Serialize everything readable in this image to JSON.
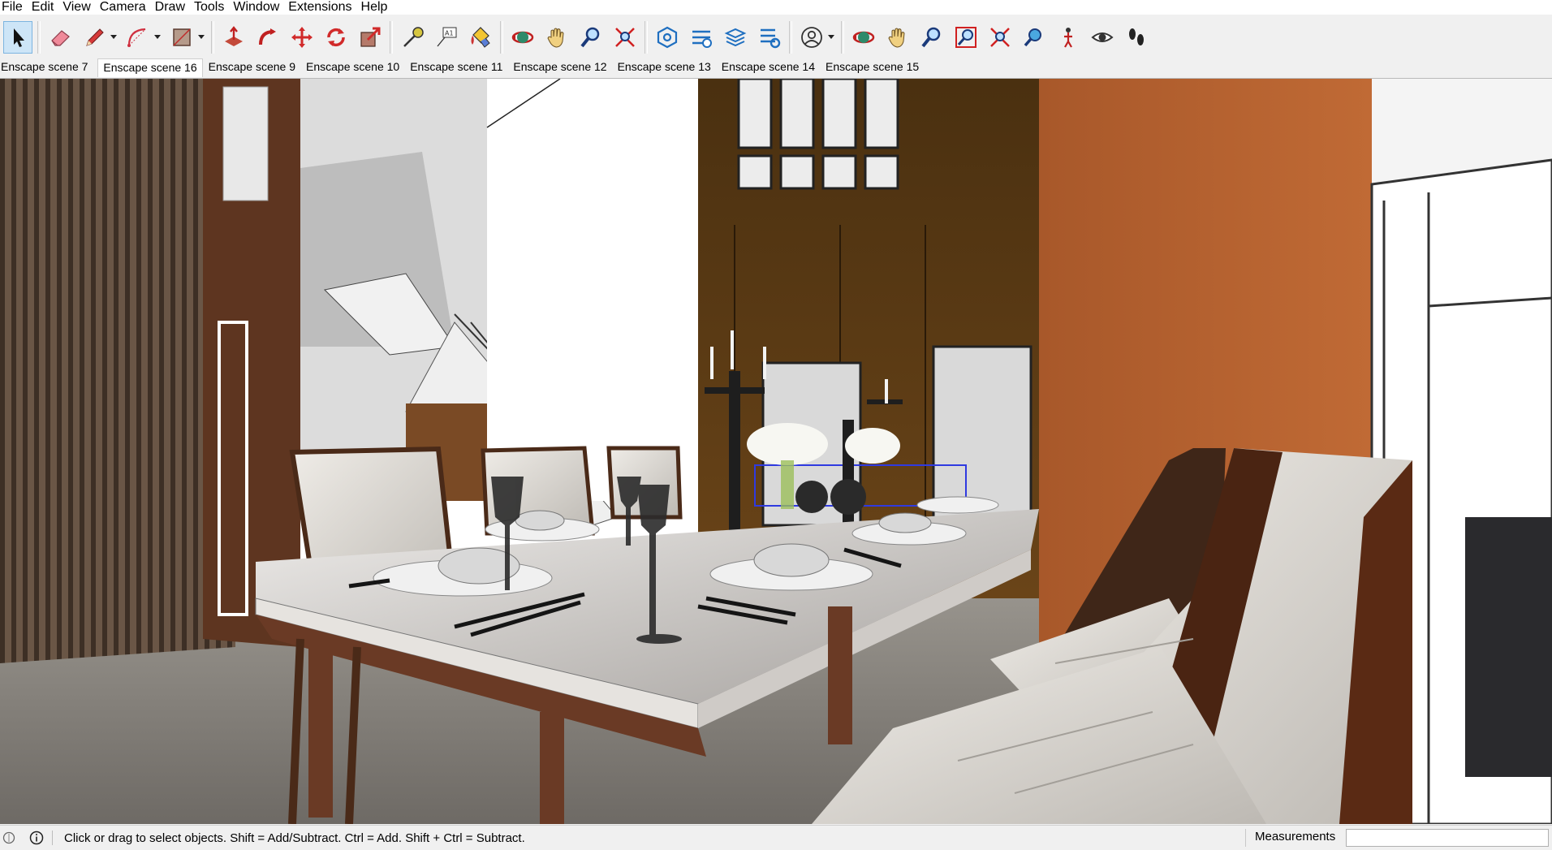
{
  "menubar": {
    "items": [
      "File",
      "Edit",
      "View",
      "Camera",
      "Draw",
      "Tools",
      "Window",
      "Extensions",
      "Help"
    ]
  },
  "toolbar": {
    "tools": [
      {
        "icon": "select-arrow-icon",
        "active": true
      },
      {
        "icon": "eraser-icon"
      },
      {
        "icon": "pencil-line-icon",
        "dropdown": true
      },
      {
        "icon": "arc-icon",
        "dropdown": true
      },
      {
        "icon": "rectangle-shape-icon",
        "dropdown": true
      },
      {
        "icon": "push-pull-icon"
      },
      {
        "icon": "follow-me-icon"
      },
      {
        "icon": "move-icon"
      },
      {
        "icon": "rotate-icon"
      },
      {
        "icon": "scale-icon"
      },
      {
        "icon": "tape-measure-icon"
      },
      {
        "icon": "text-label-icon"
      },
      {
        "icon": "paint-bucket-icon"
      },
      {
        "icon": "orbit-icon"
      },
      {
        "icon": "pan-hand-icon"
      },
      {
        "icon": "zoom-icon"
      },
      {
        "icon": "zoom-extents-icon"
      },
      {
        "icon": "warehouse-icon"
      },
      {
        "icon": "extension-warehouse-icon"
      },
      {
        "icon": "layers-icon"
      },
      {
        "icon": "extension-manager-icon"
      },
      {
        "icon": "account-user-icon",
        "dropdown": true
      },
      {
        "icon": "orbit-icon"
      },
      {
        "icon": "pan-hand-icon"
      },
      {
        "icon": "zoom-icon"
      },
      {
        "icon": "zoom-window-icon"
      },
      {
        "icon": "zoom-extents-icon"
      },
      {
        "icon": "previous-view-icon"
      },
      {
        "icon": "position-camera-icon"
      },
      {
        "icon": "look-around-eye-icon"
      },
      {
        "icon": "walk-footprints-icon"
      }
    ]
  },
  "scenes": {
    "tabs": [
      "Enscape scene 7",
      "Enscape scene 16",
      "Enscape scene 9",
      "Enscape scene 10",
      "Enscape scene 11",
      "Enscape scene 12",
      "Enscape scene 13",
      "Enscape scene 14",
      "Enscape scene 15"
    ],
    "selected": "Enscape scene 16"
  },
  "status": {
    "message": "Click or drag to select objects. Shift = Add/Subtract. Ctrl = Add. Shift + Ctrl = Subtract.",
    "measurements_label": "Measurements",
    "measurements_value": ""
  },
  "colors": {
    "wood_dark": "#5a3a25",
    "wood_orange": "#b5622d",
    "marble": "#d7d4d2",
    "upholstery": "#e4e1dc",
    "floor": "#8a8680",
    "selection_blue": "#2f3ae0"
  }
}
